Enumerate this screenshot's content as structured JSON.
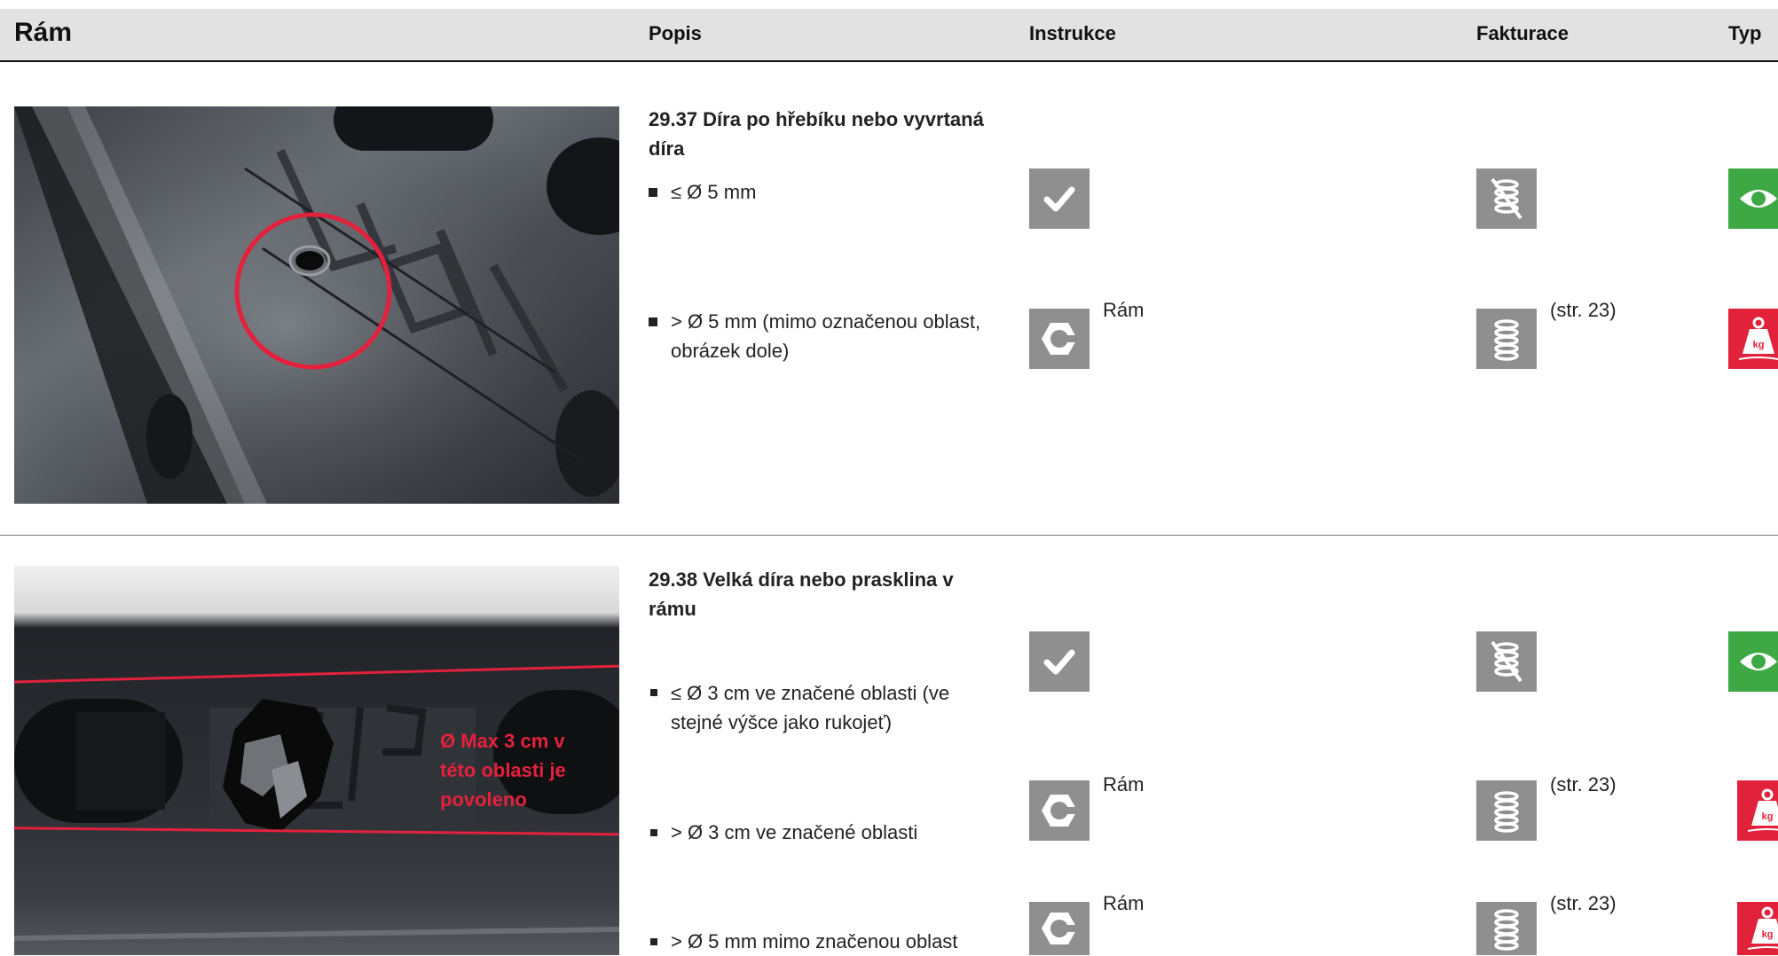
{
  "header": {
    "title": "Rám",
    "col_popis": "Popis",
    "col_instrukce": "Instrukce",
    "col_fakturace": "Fakturace",
    "col_typ": "Typ"
  },
  "section1": {
    "heading": "29.37 Díra po hřebíku nebo vyvrtaná díra",
    "items": [
      {
        "text": "≤ Ø 5 mm",
        "instruction_icon": "check-icon",
        "billing_icon": "not-billed-icon",
        "type_icon": "eye-icon"
      },
      {
        "text": "> Ø 5 mm (mimo označenou oblast, obrázek dole)",
        "instruction_icon": "nut-icon",
        "instruction_text": "Rám",
        "billing_icon": "billed-icon",
        "billing_text": "(str. 23)",
        "type_icon": "weight-icon"
      }
    ]
  },
  "section2": {
    "heading": "29.38 Velká díra nebo prasklina v rámu",
    "photo_overlay": "Ø Max 3 cm v této oblasti je povoleno",
    "items": [
      {
        "text": "≤ Ø 3 cm ve značené oblasti (ve stejné výšce jako rukojeť)",
        "instruction_icon": "check-icon",
        "billing_icon": "not-billed-icon",
        "type_icon": "eye-icon"
      },
      {
        "text": "> Ø 3 cm ve značené oblasti",
        "instruction_icon": "nut-icon",
        "instruction_text": "Rám",
        "billing_icon": "billed-icon",
        "billing_text": "(str. 23)",
        "type_icon": "weight-icon"
      },
      {
        "text": "> Ø 5 mm mimo značenou oblast",
        "instruction_icon": "nut-icon",
        "instruction_text": "Rám",
        "billing_icon": "billed-icon",
        "billing_text": "(str. 23)",
        "type_icon": "weight-icon"
      }
    ]
  },
  "colors": {
    "header_bg": "#e2e2e2",
    "icon_gray": "#8f8f8f",
    "eye_green": "#3ea844",
    "weight_red": "#e2223a",
    "marking_red": "#e4213c"
  }
}
